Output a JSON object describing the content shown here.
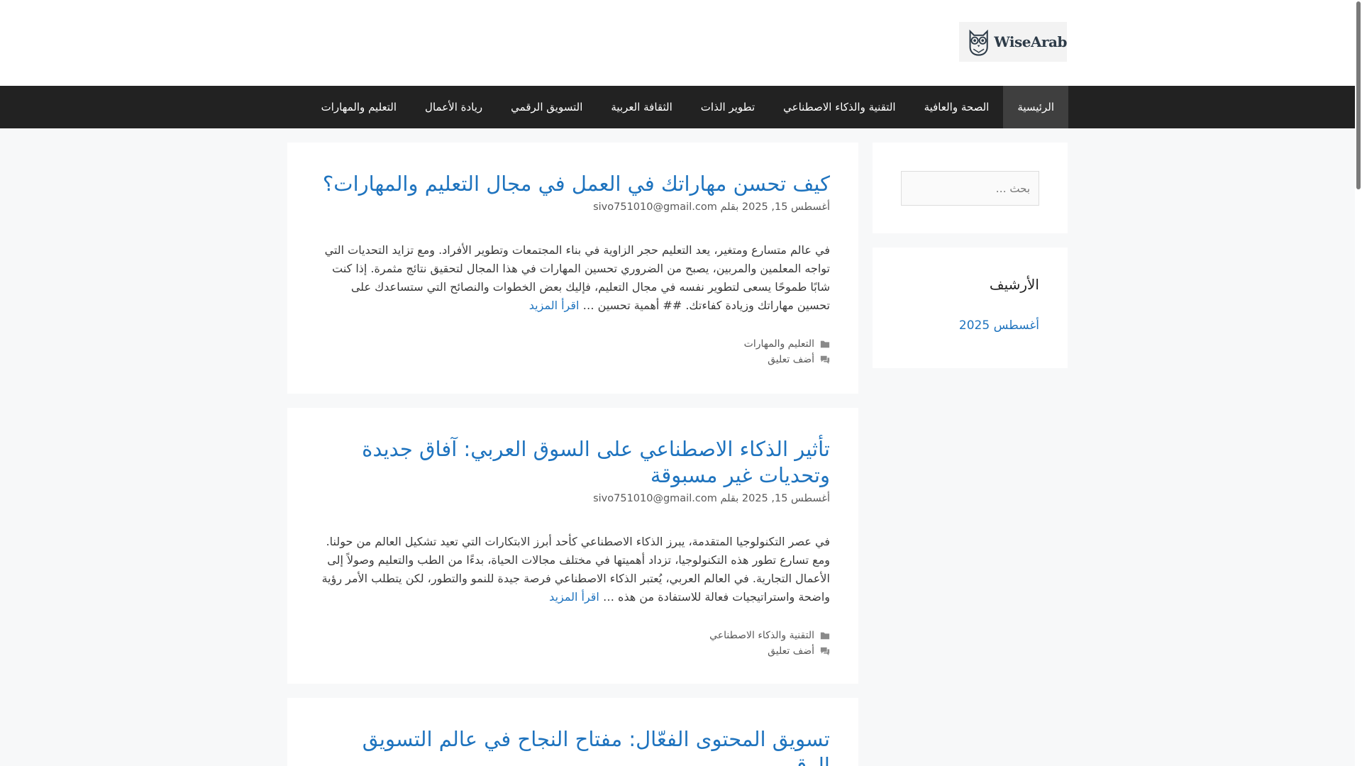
{
  "site": {
    "logo_text": "WiseArab"
  },
  "nav": {
    "items": [
      {
        "label": "الرئيسية",
        "active": true
      },
      {
        "label": "الصحة والعافية"
      },
      {
        "label": "التقنية والذكاء الاصطناعي"
      },
      {
        "label": "تطوير الذات"
      },
      {
        "label": "الثقافة العربية"
      },
      {
        "label": "التسويق الرقمي"
      },
      {
        "label": "ريادة الأعمال"
      },
      {
        "label": "التعليم والمهارات"
      }
    ]
  },
  "posts": [
    {
      "title": "كيف تحسن مهاراتك في العمل في مجال التعليم والمهارات؟",
      "date": "أغسطس 15, 2025",
      "by": "بقلم",
      "author": "sivo751010@gmail.com",
      "excerpt": "في عالم متسارع ومتغير، يعد التعليم حجر الزاوية في بناء المجتمعات وتطوير الأفراد. ومع تزايد التحديات التي تواجه المعلمين والمربين، يصبح من الضروري تحسين المهارات في هذا المجال لتحقيق نتائج مثمرة. إذا كنت شابًا طموحًا يسعى لتطوير نفسه في مجال التعليم، فإليك بعض الخطوات والنصائح التي ستساعدك على تحسين مهاراتك وزيادة كفاءتك. ## أهمية تحسين …",
      "read_more": "اقرأ المزيد",
      "category": "التعليم والمهارات",
      "comment": "أضف تعليق"
    },
    {
      "title": "تأثير الذكاء الاصطناعي على السوق العربي: آفاق جديدة وتحديات غير مسبوقة",
      "date": "أغسطس 15, 2025",
      "by": "بقلم",
      "author": "sivo751010@gmail.com",
      "excerpt": "في عصر التكنولوجيا المتقدمة، يبرز الذكاء الاصطناعي كأحد أبرز الابتكارات التي تعيد تشكيل العالم من حولنا. ومع تسارع تطور هذه التكنولوجيا، تزداد أهميتها في مختلف مجالات الحياة، بدءًا من الطب والتعليم وصولاً إلى الأعمال التجارية. في العالم العربي، يُعتبر الذكاء الاصطناعي فرصة جيدة للنمو والتطور، لكن يتطلب الأمر رؤية واضحة واستراتيجيات فعالة للاستفادة من هذه …",
      "read_more": "اقرأ المزيد",
      "category": "التقنية والذكاء الاصطناعي",
      "comment": "أضف تعليق"
    },
    {
      "title": "تسويق المحتوى الفعّال: مفتاح النجاح في عالم التسويق الرقمي"
    }
  ],
  "sidebar": {
    "search_placeholder": "بحث …",
    "archive_title": "الأرشيف",
    "archive_link": "أغسطس 2025"
  }
}
